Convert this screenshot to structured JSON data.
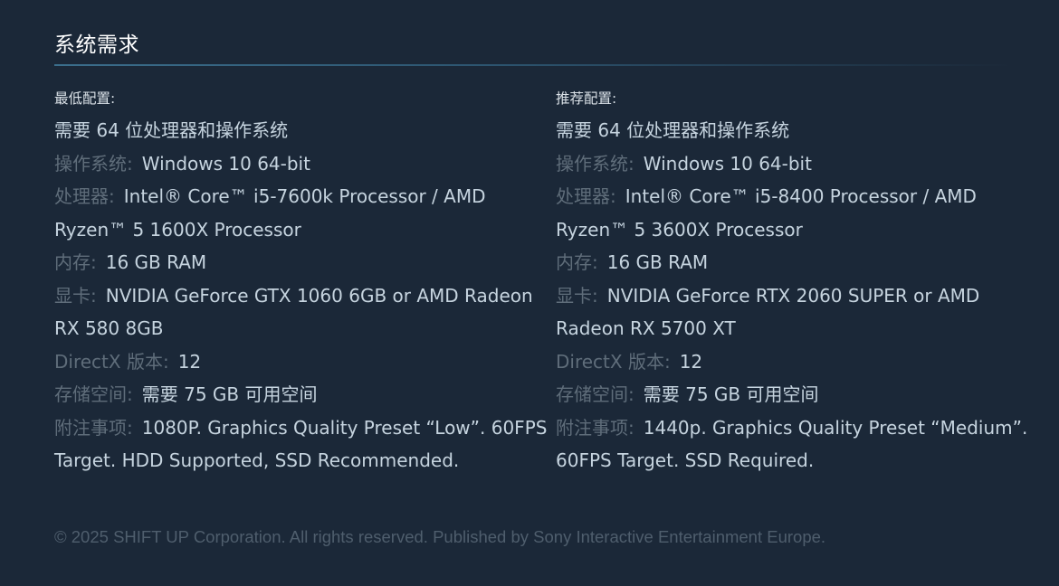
{
  "section": {
    "title": "系统需求"
  },
  "minimum": {
    "heading": "最低配置:",
    "requirement": "需要 64 位处理器和操作系统",
    "os_label": "操作系统:",
    "os_value": "Windows 10 64-bit",
    "cpu_label": "处理器:",
    "cpu_value": "Intel® Core™ i5-7600k Processor / AMD Ryzen™ 5 1600X Processor",
    "ram_label": "内存:",
    "ram_value": "16 GB RAM",
    "gpu_label": "显卡:",
    "gpu_value": "NVIDIA GeForce GTX 1060 6GB or AMD Radeon RX 580 8GB",
    "dx_label": "DirectX 版本:",
    "dx_value": "12",
    "storage_label": "存储空间:",
    "storage_value": "需要 75 GB 可用空间",
    "notes_label": "附注事项:",
    "notes_value": "1080P. Graphics Quality Preset “Low”. 60FPS Target. HDD Supported, SSD Recommended."
  },
  "recommended": {
    "heading": "推荐配置:",
    "requirement": "需要 64 位处理器和操作系统",
    "os_label": "操作系统:",
    "os_value": "Windows 10 64-bit",
    "cpu_label": "处理器:",
    "cpu_value": "Intel® Core™ i5-8400 Processor / AMD Ryzen™ 5 3600X Processor",
    "ram_label": "内存:",
    "ram_value": "16 GB RAM",
    "gpu_label": "显卡:",
    "gpu_value": "NVIDIA GeForce RTX 2060 SUPER or AMD Radeon RX 5700 XT",
    "dx_label": "DirectX 版本:",
    "dx_value": "12",
    "storage_label": "存储空间:",
    "storage_value": "需要 75 GB 可用空间",
    "notes_label": "附注事项:",
    "notes_value": "1440p. Graphics Quality Preset “Medium”. 60FPS Target. SSD Required."
  },
  "footer": {
    "copyright": "© 2025 SHIFT UP Corporation. All rights reserved. Published by Sony Interactive Entertainment Europe."
  }
}
